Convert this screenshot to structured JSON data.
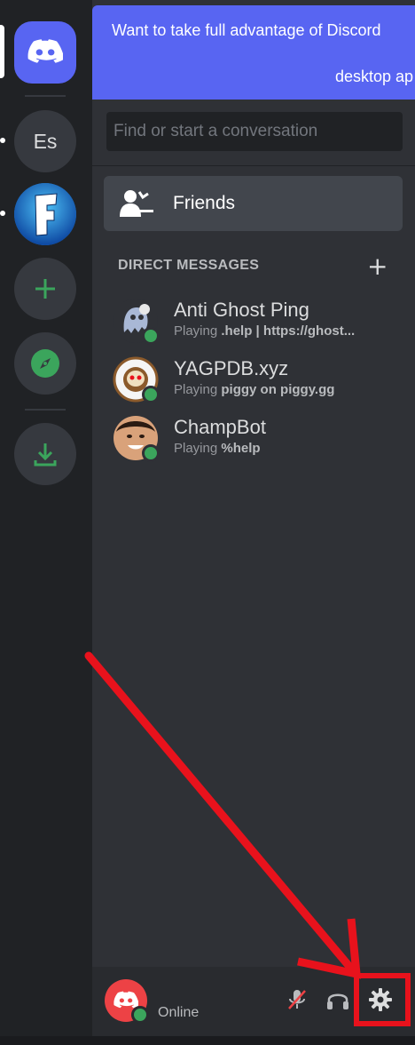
{
  "banner": {
    "line1": "Want to take full advantage of Discord",
    "line2": "desktop ap"
  },
  "servers": [
    {
      "name": "home",
      "icon": "discord-logo-icon"
    },
    {
      "name": "Es",
      "label": "Es"
    },
    {
      "name": "fortnite",
      "icon": "fortnite-logo-icon",
      "label": "F"
    },
    {
      "name": "add-server",
      "icon": "plus-icon"
    },
    {
      "name": "explore",
      "icon": "compass-icon"
    },
    {
      "name": "download",
      "icon": "download-icon"
    }
  ],
  "search": {
    "placeholder": "Find or start a conversation"
  },
  "friends": {
    "label": "Friends",
    "icon": "friends-wave-icon"
  },
  "direct_messages": {
    "header": "DIRECT MESSAGES",
    "items": [
      {
        "name": "Anti Ghost Ping",
        "activity_prefix": "Playing",
        "activity": ".help | https://ghost...",
        "status": "online"
      },
      {
        "name": "YAGPDB.xyz",
        "activity_prefix": "Playing",
        "activity": "piggy on piggy.gg",
        "status": "online"
      },
      {
        "name": "ChampBot",
        "activity_prefix": "Playing",
        "activity": "%help",
        "status": "online"
      }
    ]
  },
  "user": {
    "status_text": "Online"
  },
  "controls": {
    "mute_icon": "microphone-muted-icon",
    "deafen_icon": "headphones-icon",
    "settings_icon": "gear-icon"
  },
  "colors": {
    "blurple": "#5865f2",
    "online": "#3ba55c",
    "annotation": "#e8121c"
  }
}
